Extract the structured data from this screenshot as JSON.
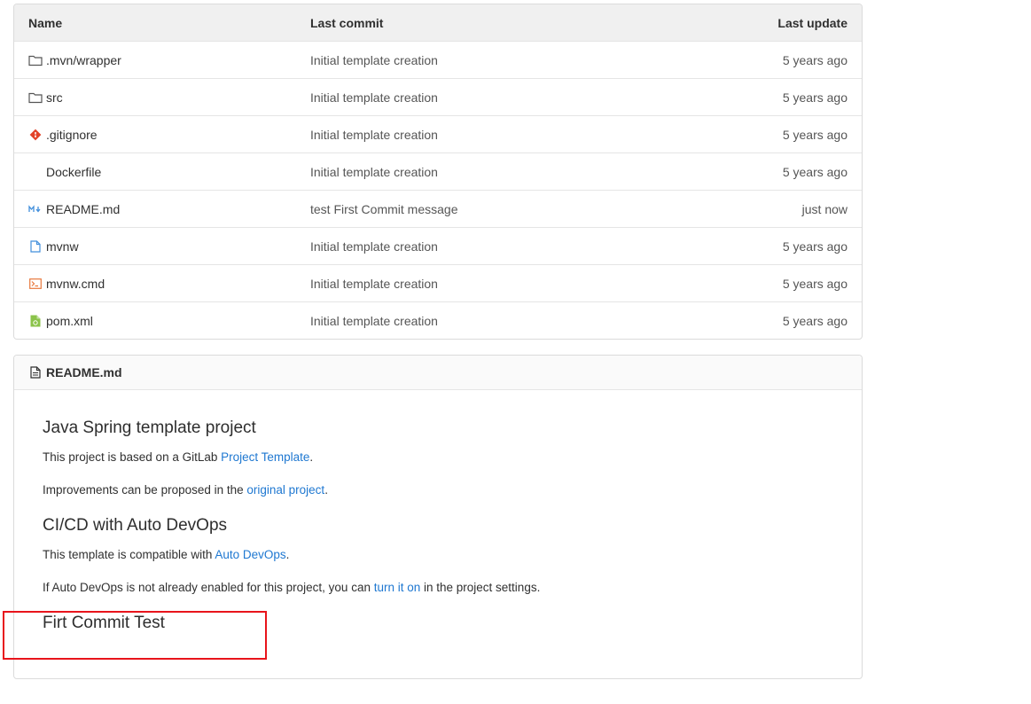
{
  "table": {
    "headers": {
      "name": "Name",
      "last_commit": "Last commit",
      "last_update": "Last update"
    },
    "rows": [
      {
        "icon": "folder-icon",
        "name": ".mvn/wrapper",
        "commit": "Initial template creation",
        "update": "5 years ago"
      },
      {
        "icon": "folder-icon",
        "name": "src",
        "commit": "Initial template creation",
        "update": "5 years ago"
      },
      {
        "icon": "git-icon",
        "name": ".gitignore",
        "commit": "Initial template creation",
        "update": "5 years ago"
      },
      {
        "icon": "none",
        "name": "Dockerfile",
        "commit": "Initial template creation",
        "update": "5 years ago"
      },
      {
        "icon": "markdown-icon",
        "name": "README.md",
        "commit": "test First Commit message",
        "update": "just now"
      },
      {
        "icon": "file-icon",
        "name": "mvnw",
        "commit": "Initial template creation",
        "update": "5 years ago"
      },
      {
        "icon": "terminal-icon",
        "name": "mvnw.cmd",
        "commit": "Initial template creation",
        "update": "5 years ago"
      },
      {
        "icon": "xml-icon",
        "name": "pom.xml",
        "commit": "Initial template creation",
        "update": "5 years ago"
      }
    ]
  },
  "readme": {
    "header": "README.md",
    "h1": "Java Spring template project",
    "p1_before": "This project is based on a GitLab ",
    "p1_link": "Project Template",
    "p1_after": ".",
    "p2_before": "Improvements can be proposed in the ",
    "p2_link": "original project",
    "p2_after": ".",
    "h2": "CI/CD with Auto DevOps",
    "p3_before": "This template is compatible with ",
    "p3_link": "Auto DevOps",
    "p3_after": ".",
    "p4_before": "If Auto DevOps is not already enabled for this project, you can ",
    "p4_link": "turn it on",
    "p4_after": " in the project settings.",
    "h3": "Firt Commit Test"
  },
  "colors": {
    "link": "#1f78d1",
    "highlight": "#e8141b",
    "header_bg": "#f0f0f0"
  }
}
